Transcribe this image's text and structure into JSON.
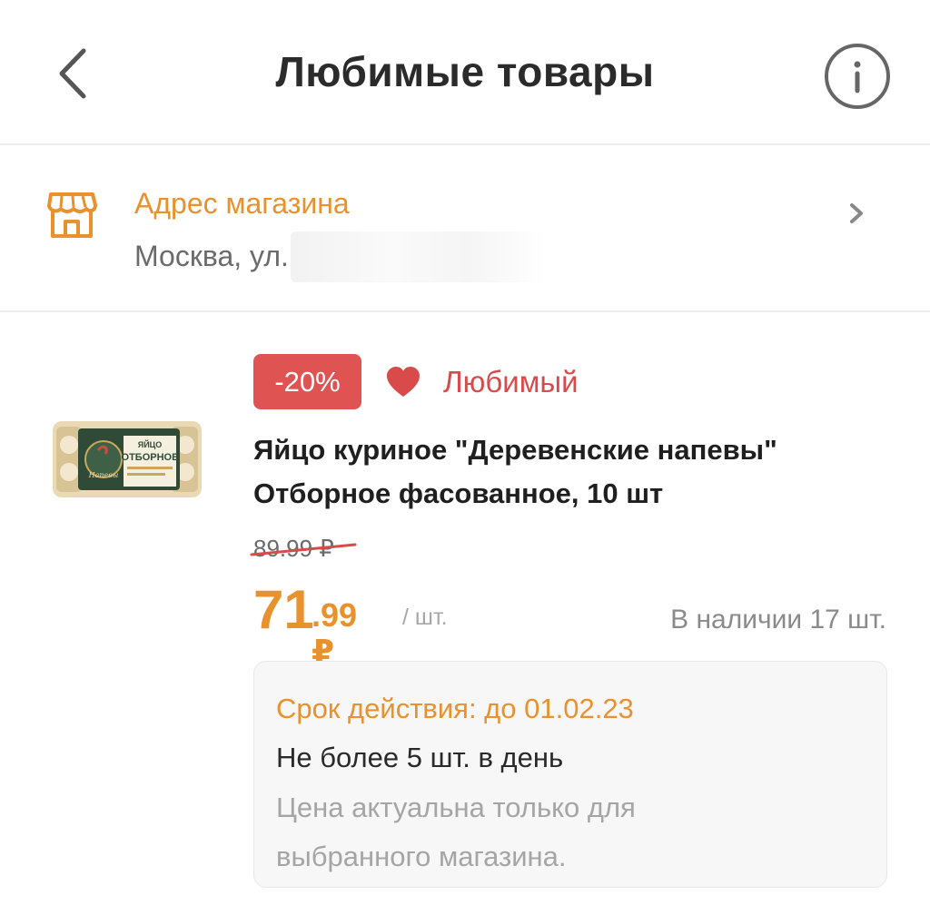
{
  "header": {
    "title": "Любимые товары",
    "back_icon": "chevron-left-icon",
    "info_icon": "info-icon"
  },
  "store": {
    "label": "Адрес магазина",
    "address": "Москва, ул.",
    "icon": "store-icon",
    "chevron_icon": "chevron-right-icon"
  },
  "product": {
    "discount_badge": "-20%",
    "favorite_label": "Любимый",
    "favorite_icon": "heart-icon",
    "name": "Яйцо куриное \"Деревенские напевы\" Отборное фасованное, 10 шт",
    "old_price": "89.99 ₽",
    "price_integer": "71",
    "price_fraction": ".99 ₽",
    "price_unit": "/ шт.",
    "stock": "В наличии 17 шт.",
    "image_label_top": "ЯЙЦО",
    "image_label_main": "ОТБОРНОЕ",
    "image_brand": "Напевы"
  },
  "promo": {
    "validity": "Срок действия: до 01.02.23",
    "limit": "Не более 5 шт. в день",
    "note": "Цена актуальна только для выбранного магазина."
  },
  "colors": {
    "accent_orange": "#e8912d",
    "badge_red": "#e05353",
    "heart_red": "#d94a4a"
  }
}
